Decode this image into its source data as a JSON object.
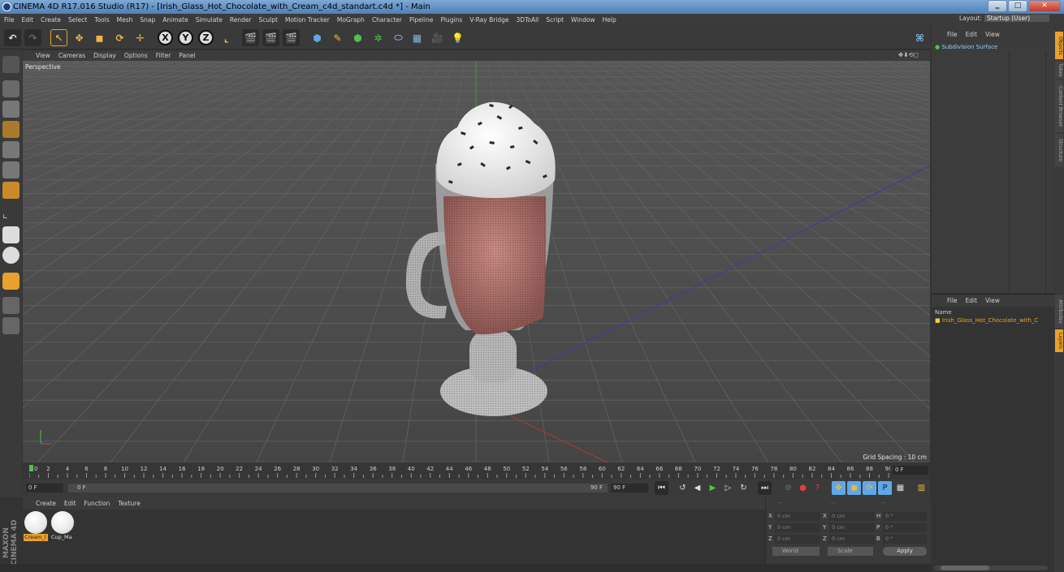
{
  "window": {
    "title": "CINEMA 4D R17.016 Studio (R17) - [Irish_Glass_Hot_Chocolate_with_Cream_c4d_standart.c4d *] - Main",
    "buttons": [
      "‗",
      "□",
      "✕"
    ]
  },
  "menubar": {
    "items": [
      "File",
      "Edit",
      "Create",
      "Select",
      "Tools",
      "Mesh",
      "Snap",
      "Animate",
      "Simulate",
      "Render",
      "Sculpt",
      "Motion Tracker",
      "MoGraph",
      "Character",
      "Pipeline",
      "Plugins",
      "V-Ray Bridge",
      "3DToAll",
      "Script",
      "Window",
      "Help"
    ],
    "layout_label": "Layout:",
    "layout_value": "Startup (User)"
  },
  "toolbar": {
    "axis_x": "X",
    "axis_y": "Y",
    "axis_z": "Z"
  },
  "viewport": {
    "menu": [
      "View",
      "Cameras",
      "Display",
      "Options",
      "Filter",
      "Panel"
    ],
    "label": "Perspective",
    "grid_spacing": "Grid Spacing : 10 cm",
    "nav_icons": "✥⬇⟲◻"
  },
  "timeline": {
    "ticks": [
      "0",
      "2",
      "4",
      "6",
      "8",
      "10",
      "12",
      "14",
      "16",
      "18",
      "20",
      "22",
      "24",
      "26",
      "28",
      "30",
      "32",
      "34",
      "36",
      "38",
      "40",
      "42",
      "44",
      "46",
      "48",
      "50",
      "52",
      "54",
      "56",
      "58",
      "60",
      "62",
      "64",
      "66",
      "68",
      "70",
      "72",
      "74",
      "76",
      "78",
      "80",
      "82",
      "84",
      "86",
      "88",
      "90"
    ],
    "frame_field": "0 F"
  },
  "playback": {
    "start": "0 F",
    "current": "0 F",
    "end_slider": "90 F",
    "end": "90 F"
  },
  "materials": {
    "menu": [
      "Create",
      "Edit",
      "Function",
      "Texture"
    ],
    "items": [
      {
        "label": "Cream_l",
        "selected": true
      },
      {
        "label": "Cup_Ma",
        "selected": false
      }
    ],
    "brand": "MAXON CINEMA 4D"
  },
  "coordinates": {
    "header_a": "--",
    "header_b": "--",
    "header_c": "--",
    "rows": [
      {
        "a": "X",
        "av": "0 cm",
        "b": "X",
        "bv": "0 cm",
        "c": "H",
        "cv": "0 °"
      },
      {
        "a": "Y",
        "av": "0 cm",
        "b": "Y",
        "bv": "0 cm",
        "c": "P",
        "cv": "0 °"
      },
      {
        "a": "Z",
        "av": "0 cm",
        "b": "Z",
        "bv": "0 cm",
        "c": "B",
        "cv": "0 °"
      }
    ],
    "mode": "World",
    "scale": "Scale",
    "apply": "Apply"
  },
  "objects": {
    "menu": [
      "File",
      "Edit",
      "View"
    ],
    "item": "Subdivision Surface"
  },
  "attributes": {
    "menu": [
      "File",
      "Edit",
      "View"
    ],
    "name_header": "Name",
    "layer": "Irish_Glass_Hot_Chocolate_with_C"
  },
  "side_tabs": [
    "Objects",
    "Takes",
    "Content Browser",
    "Structure",
    "Attributes",
    "Layers"
  ],
  "colors": {
    "accent": "#e8a12c",
    "viewport_bg": "#4a4a4a",
    "panel_bg": "#333333"
  }
}
